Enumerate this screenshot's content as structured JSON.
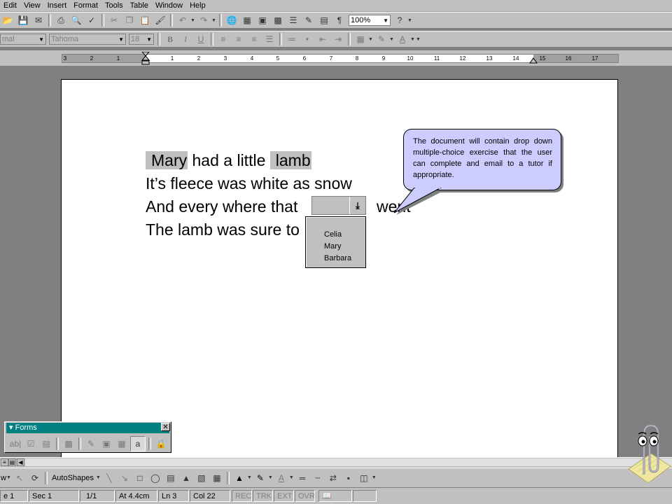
{
  "menu": [
    "Edit",
    "View",
    "Insert",
    "Format",
    "Tools",
    "Table",
    "Window",
    "Help"
  ],
  "toolbar": {
    "zoom": "100%",
    "style_value": "mal",
    "font_value": "Tahoma",
    "size_value": "18",
    "bold": "B",
    "italic": "I",
    "underline": "U",
    "autoshapes": "AutoShapes"
  },
  "ruler": [
    "3",
    "2",
    "1",
    "1",
    "2",
    "3",
    "4",
    "5",
    "6",
    "7",
    "8",
    "9",
    "10",
    "11",
    "12",
    "13",
    "14",
    "15",
    "16",
    "17"
  ],
  "document": {
    "line1": [
      "Mary",
      " had a little ",
      "lamb"
    ],
    "line2": "It’s fleece was white as snow",
    "line3a": "And every where that",
    "line3b": "went",
    "line4": "The lamb was sure to"
  },
  "dropdown": {
    "options": [
      "Celia",
      "Mary",
      "Barbara"
    ]
  },
  "callout": {
    "text": "The document will contain drop down multiple-choice exercise that the user can complete and email to a tutor if appropriate."
  },
  "forms_toolbar": {
    "title": "Forms",
    "close": "✕"
  },
  "status": {
    "page": "e 1",
    "sec": "Sec 1",
    "pages": "1/1",
    "at": "At 4.4cm",
    "ln": "Ln 3",
    "col": "Col 22",
    "rec": "REC",
    "trk": "TRK",
    "ext": "EXT",
    "ovr": "OVR"
  },
  "drawing_toolbar": {
    "draw": "w"
  },
  "colors": {
    "field_shading": "#c0c0c0",
    "callout_fill": "#ccccff",
    "forms_titlebar": "#008080",
    "chrome": "#c0c0c0"
  }
}
